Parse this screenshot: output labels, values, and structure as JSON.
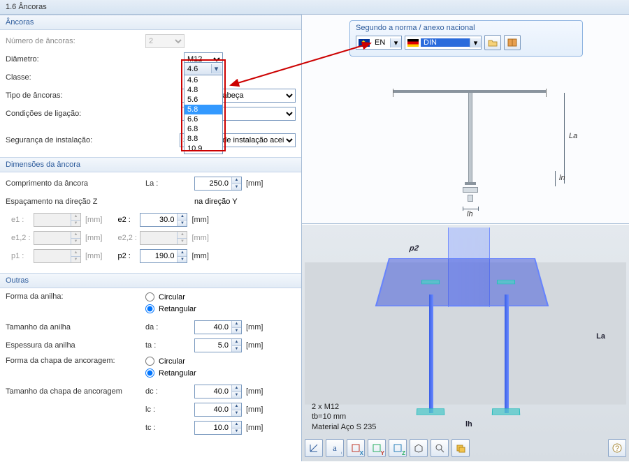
{
  "title": "1.6 Âncoras",
  "groups": {
    "ancoras": "Âncoras",
    "dimensoes": "Dimensões da âncora",
    "outras": "Outras"
  },
  "ancoras": {
    "numero_label": "Número de âncoras:",
    "numero_value": "2",
    "diametro_label": "Diâmetro:",
    "diametro_value": "M12",
    "classe_label": "Classe:",
    "classe_value": "4.6",
    "classe_options": [
      "4.6",
      "4.8",
      "5.6",
      "5.8",
      "6.6",
      "6.8",
      "8.8",
      "10.9"
    ],
    "classe_selected": "5.8",
    "tipo_label": "Tipo de âncoras:",
    "tipo_value": "Pernos de cabeça redonda com cabeça",
    "tipo_visible_suffix": "uros com cabeça",
    "condicoes_label": "Condições de ligação:",
    "condicoes_value": "",
    "seguranca_label": "Segurança de instalação:",
    "seguranca_value": "Segurança de instalação aceitável"
  },
  "dimensoes": {
    "comprimento_label": "Comprimento da âncora",
    "comprimento_sym": "La :",
    "comprimento_value": "250.0",
    "unit_mm": "[mm]",
    "espac_z_label": "Espaçamento na direção Z",
    "espac_y_header": "na direção Y",
    "e1_sym": "e1 :",
    "e1_value": "",
    "e2_sym": "e2 :",
    "e2_value": "30.0",
    "e12_sym": "e1,2 :",
    "e12_value": "",
    "e22_sym": "e2,2 :",
    "e22_value": "",
    "p1_sym": "p1 :",
    "p1_value": "",
    "p2_sym": "p2 :",
    "p2_value": "190.0"
  },
  "outras": {
    "forma_anilha_label": "Forma da anilha:",
    "circular": "Circular",
    "retangular": "Retangular",
    "tam_anilha_label": "Tamanho da anilha",
    "da_sym": "da :",
    "da_value": "40.0",
    "esp_anilha_label": "Espessura da anilha",
    "ta_sym": "ta :",
    "ta_value": "5.0",
    "forma_chapa_label": "Forma da chapa de ancoragem:",
    "tam_chapa_label": "Tamanho da chapa de ancoragem",
    "dc_sym": "dc :",
    "dc_value": "40.0",
    "lc_sym": "lc :",
    "lc_value": "40.0",
    "tc_sym": "tc :",
    "tc_value": "10.0"
  },
  "norm": {
    "title": "Segundo a norma / anexo nacional",
    "code": "EN",
    "annex": "DIN"
  },
  "diagram": {
    "la": "La",
    "ln": "ln",
    "lh": "lh"
  },
  "view3d": {
    "line1": "2 x M12",
    "line2": "tb=10 mm",
    "line3": "Material Aço S 235",
    "p2": "p2",
    "la": "La",
    "lh": "lh"
  },
  "toolbar_icons": [
    "axis",
    "text",
    "xy",
    "xz",
    "yz",
    "iso",
    "box",
    "fit",
    "layers"
  ],
  "help_icon": "help"
}
